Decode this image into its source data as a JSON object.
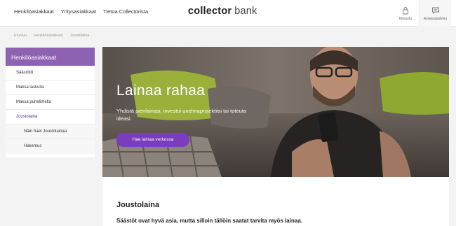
{
  "header": {
    "nav": [
      "Henkilöasiakkaat",
      "Yritysasiakkaat",
      "Tietoa Collectorista"
    ],
    "logo_bold": "collector",
    "logo_light": "bank",
    "login_label": "Kirjaudu",
    "contact_label": "Asiakaspalvelu"
  },
  "breadcrumb": [
    "Etusivu",
    "Henkilöasiakkaat",
    "Joustolaina"
  ],
  "sidebar": {
    "heading": "Henkilöasiakkaat",
    "items": [
      {
        "label": "Säästötili"
      },
      {
        "label": "Maksa laskulla"
      },
      {
        "label": "Maksa puhelimella"
      },
      {
        "label": "Joustolaina"
      },
      {
        "label": "Näin haet Joustolainaa"
      },
      {
        "label": "Hakemus"
      }
    ]
  },
  "hero": {
    "title": "Lainaa rahaa",
    "subtitle": "Yhdistä pienlainasi, investoi unelmaprojektiisi tai toteuta ideasi.",
    "button": "Hae lainaa verkossa"
  },
  "content": {
    "title": "Joustolaina",
    "text": "Säästöt ovat hyvä asia, mutta silloin tällöin saatat tarvita myös lainaa."
  },
  "colors": {
    "accent": "#8e62b3",
    "button": "#7a3dbd"
  }
}
